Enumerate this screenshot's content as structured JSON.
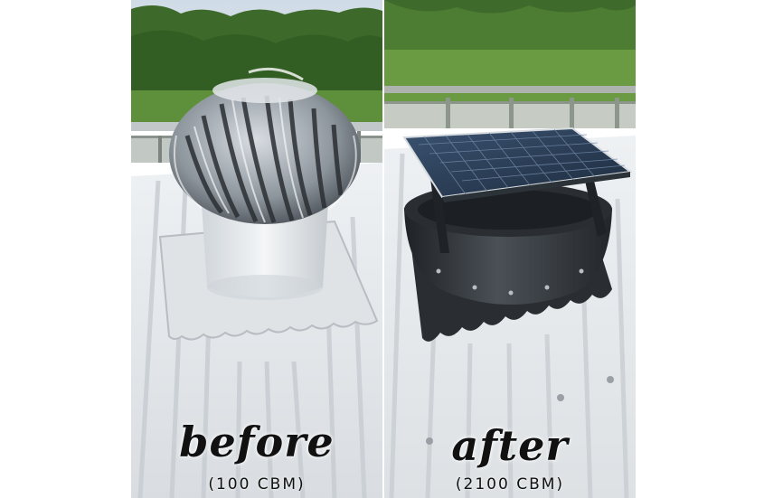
{
  "panels": [
    {
      "caption": "before",
      "subcaption": "(100 CBM)",
      "subject": "turbine-ventilator-icon"
    },
    {
      "caption": "after",
      "subcaption": "(2100 CBM)",
      "subject": "solar-exhaust-fan-icon"
    }
  ],
  "colors": {
    "sky": "#dfe7ee",
    "trees": "#3f6b2c",
    "grass": "#5e8f3a",
    "roof": "#e9ecef",
    "roof_shadow": "#c9ced3",
    "fan_body": "#2f3338",
    "solar_panel": "#2c3e55"
  }
}
